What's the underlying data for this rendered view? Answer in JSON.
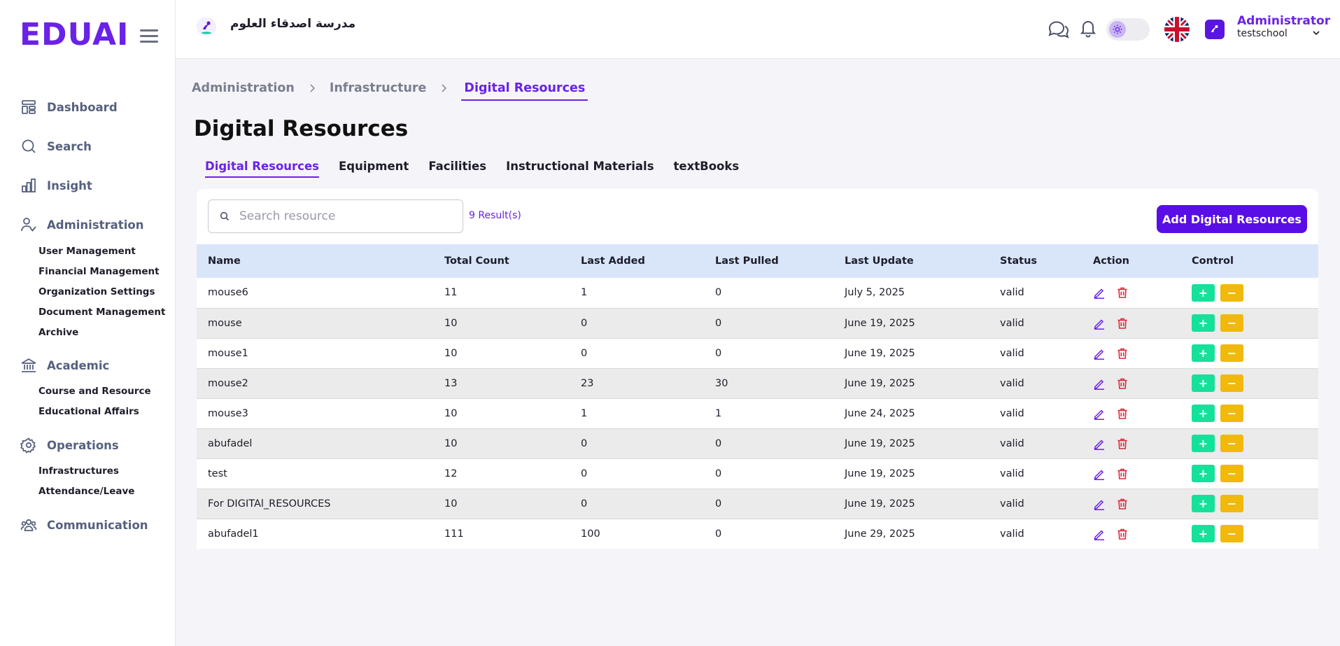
{
  "brand": {
    "logo_text": "EDUAI",
    "accent": "#6a22e8",
    "primary_button": "#5a0ee6"
  },
  "sidebar": {
    "main_items": [
      {
        "label": "Dashboard",
        "icon": "dashboard-icon"
      },
      {
        "label": "Search",
        "icon": "search-icon"
      },
      {
        "label": "Insight",
        "icon": "bar-chart-icon"
      },
      {
        "label": "Administration",
        "icon": "user-check-icon"
      },
      {
        "label": "Academic",
        "icon": "institution-icon"
      },
      {
        "label": "Operations",
        "icon": "gear-icon"
      },
      {
        "label": "Communication",
        "icon": "users-icon"
      }
    ],
    "administration_sub": [
      "User Management",
      "Financial Management",
      "Organization Settings",
      "Document Management",
      "Archive"
    ],
    "academic_sub": [
      "Course and Resource",
      "Educational Affairs"
    ],
    "operations_sub": [
      "Infrastructures",
      "Attendance/Leave"
    ]
  },
  "header": {
    "school_name": "مدرسة اصدقاء العلوم",
    "user_name": "Administrator",
    "user_school": "testschool",
    "icons": [
      "chat-icon",
      "bell-icon",
      "theme-toggle-icon",
      "uk-flag-icon",
      "avatar-icon",
      "chevron-down-icon"
    ]
  },
  "breadcrumb": [
    "Administration",
    "Infrastructure",
    "Digital Resources"
  ],
  "page": {
    "title": "Digital Resources"
  },
  "tabs": [
    "Digital Resources",
    "Equipment",
    "Facilities",
    "Instructional Materials",
    "textBooks"
  ],
  "search": {
    "placeholder": "Search resource",
    "value": ""
  },
  "results": {
    "count_label": "9 Result(s)"
  },
  "add_button_label": "Add Digital Resources",
  "table": {
    "columns": [
      "Name",
      "Total Count",
      "Last Added",
      "Last Pulled",
      "Last Update",
      "Status",
      "Action",
      "Control"
    ],
    "rows": [
      {
        "name": "mouse6",
        "total": "11",
        "added": "1",
        "pulled": "0",
        "updated": "July 5, 2025",
        "status": "valid"
      },
      {
        "name": "mouse",
        "total": "10",
        "added": "0",
        "pulled": "0",
        "updated": "June 19, 2025",
        "status": "valid"
      },
      {
        "name": "mouse1",
        "total": "10",
        "added": "0",
        "pulled": "0",
        "updated": "June 19, 2025",
        "status": "valid"
      },
      {
        "name": "mouse2",
        "total": "13",
        "added": "23",
        "pulled": "30",
        "updated": "June 19, 2025",
        "status": "valid"
      },
      {
        "name": "mouse3",
        "total": "10",
        "added": "1",
        "pulled": "1",
        "updated": "June 24, 2025",
        "status": "valid"
      },
      {
        "name": "abufadel",
        "total": "10",
        "added": "0",
        "pulled": "0",
        "updated": "June 19, 2025",
        "status": "valid"
      },
      {
        "name": "test",
        "total": "12",
        "added": "0",
        "pulled": "0",
        "updated": "June 19, 2025",
        "status": "valid"
      },
      {
        "name": "For DIGITAl_RESOURCES",
        "total": "10",
        "added": "0",
        "pulled": "0",
        "updated": "June 19, 2025",
        "status": "valid"
      },
      {
        "name": "abufadel1",
        "total": "111",
        "added": "100",
        "pulled": "0",
        "updated": "June 29, 2025",
        "status": "valid"
      }
    ],
    "control_plus": "+",
    "control_minus": "−"
  }
}
